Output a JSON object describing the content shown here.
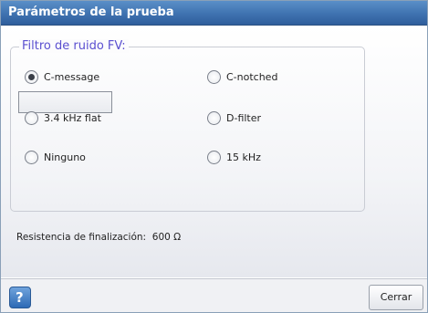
{
  "dialog": {
    "title": "Parámetros de la prueba"
  },
  "filter_group": {
    "title": "Filtro de ruido FV:",
    "options": [
      {
        "label": "C-message",
        "selected": true
      },
      {
        "label": "C-notched",
        "selected": false
      },
      {
        "label": "3.4 kHz flat",
        "selected": false
      },
      {
        "label": "D-filter",
        "selected": false
      },
      {
        "label": "Ninguno",
        "selected": false
      },
      {
        "label": "15 kHz",
        "selected": false
      }
    ]
  },
  "termination": {
    "label": "Resistencia de finalización:",
    "value": "600 Ω"
  },
  "footer": {
    "help_icon": "question-circle-icon",
    "close_label": "Cerrar"
  }
}
